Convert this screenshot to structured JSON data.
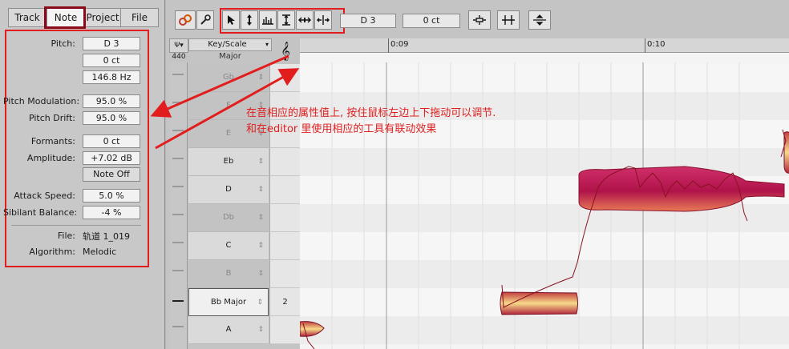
{
  "tabs": [
    {
      "label": "Track",
      "active": false
    },
    {
      "label": "Note",
      "active": true
    },
    {
      "label": "Project",
      "active": false
    },
    {
      "label": "File",
      "active": false
    }
  ],
  "inspector": {
    "pitch_label": "Pitch:",
    "pitch_note": "D 3",
    "pitch_cents": "0 ct",
    "pitch_hz": "146.8 Hz",
    "pitch_mod_label": "Pitch Modulation:",
    "pitch_mod_value": "95.0 %",
    "pitch_drift_label": "Pitch Drift:",
    "pitch_drift_value": "95.0 %",
    "formants_label": "Formants:",
    "formants_value": "0 ct",
    "amplitude_label": "Amplitude:",
    "amplitude_value": "+7.02 dB",
    "note_off_label": "Note Off",
    "attack_label": "Attack Speed:",
    "attack_value": "5.0 %",
    "sibilant_label": "Sibilant Balance:",
    "sibilant_value": "-4 %",
    "file_label": "File:",
    "file_value": "轨道 1_019",
    "algorithm_label": "Algorithm:",
    "algorithm_value": "Melodic"
  },
  "toolbar": {
    "note_field": "D 3",
    "cents_field": "0 ct"
  },
  "header": {
    "tuning": "440",
    "key_scale_label": "Key/Scale",
    "key_scale_value": "Major",
    "time_marker_1": "0:09",
    "time_marker_2": "0:10"
  },
  "keys": [
    {
      "label": "Gb",
      "dim": true,
      "scale": ""
    },
    {
      "label": "F",
      "dim": true,
      "scale": ""
    },
    {
      "label": "E",
      "dim": true,
      "scale": ""
    },
    {
      "label": "Eb",
      "dim": false,
      "scale": ""
    },
    {
      "label": "D",
      "dim": false,
      "scale": ""
    },
    {
      "label": "Db",
      "dim": true,
      "scale": ""
    },
    {
      "label": "C",
      "dim": false,
      "scale": ""
    },
    {
      "label": "B",
      "dim": true,
      "scale": ""
    },
    {
      "label": "Bb Major",
      "dim": false,
      "scale": "2"
    },
    {
      "label": "A",
      "dim": false,
      "scale": ""
    }
  ],
  "annotation": {
    "line1": "在音相应的属性值上, 按住鼠标左边上下拖动可以调节.",
    "line2": "和在editor 里使用相应的工具有联动效果"
  },
  "colors": {
    "highlight_red": "#e21d1d",
    "note_tab_border": "#8b0a1a",
    "blob_dark": "#b0124a",
    "blob_light": "#f7d98a"
  }
}
